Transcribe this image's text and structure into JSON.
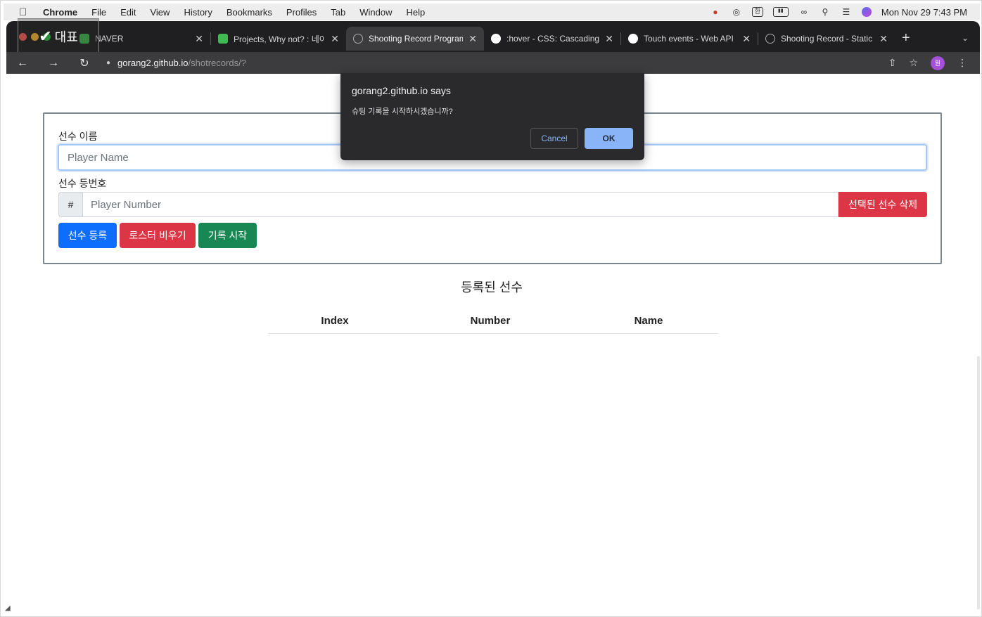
{
  "menubar": {
    "app": "Chrome",
    "items": [
      "File",
      "Edit",
      "View",
      "History",
      "Bookmarks",
      "Profiles",
      "Tab",
      "Window",
      "Help"
    ],
    "datetime": "Mon Nov 29  7:43 PM",
    "input_method": "한"
  },
  "overlay": {
    "label": "대표"
  },
  "tabs": [
    {
      "title": "NAVER",
      "icon": "naver-icon"
    },
    {
      "title": "Projects, Why not? : 네이",
      "icon": "chat-icon"
    },
    {
      "title": "Shooting Record Program",
      "icon": "globe-icon",
      "active": true
    },
    {
      "title": ":hover - CSS: Cascading",
      "icon": "mdn-icon"
    },
    {
      "title": "Touch events - Web API",
      "icon": "mdn-icon"
    },
    {
      "title": "Shooting Record - Static",
      "icon": "globe-icon"
    }
  ],
  "toolbar": {
    "url_host": "gorang2.github.io",
    "url_path": "/shotrecords/?",
    "avatar": "원"
  },
  "form": {
    "name_label": "선수 이름",
    "name_placeholder": "Player Name",
    "number_label": "선수 등번호",
    "number_prefix": "#",
    "number_placeholder": "Player Number",
    "delete_selected": "선택된 선수 삭제",
    "register": "선수 등록",
    "clear_roster": "로스터 비우기",
    "start_record": "기록 시작"
  },
  "roster": {
    "title": "등록된 선수",
    "columns": [
      "Index",
      "Number",
      "Name"
    ]
  },
  "dialog": {
    "title": "gorang2.github.io says",
    "message": "슈팅 기록을 시작하시겠습니까?",
    "cancel": "Cancel",
    "ok": "OK"
  },
  "colors": {
    "primary": "#0d6efd",
    "danger": "#dc3545",
    "success": "#198754",
    "dialog_bg": "#2a2a2c",
    "dialog_ok": "#8ab4f8"
  }
}
